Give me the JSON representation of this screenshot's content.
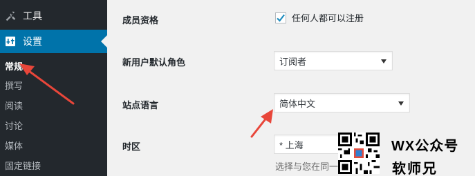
{
  "sidebar": {
    "tools_label": "工具",
    "settings_label": "设置",
    "submenu": [
      "常规",
      "撰写",
      "阅读",
      "讨论",
      "媒体",
      "固定链接"
    ]
  },
  "form": {
    "membership": {
      "label": "成员资格",
      "checkbox_label": "任何人都可以注册",
      "checked": true
    },
    "default_role": {
      "label": "新用户默认角色",
      "value": "订阅者"
    },
    "site_language": {
      "label": "站点语言",
      "value": "简体中文"
    },
    "timezone": {
      "label": "时区",
      "value": "* 上海",
      "hint": "选择与您在同一"
    }
  },
  "watermark": {
    "line1": "WX公众号",
    "line2": "软师兄"
  },
  "colors": {
    "sidebar_bg": "#23282d",
    "active_menu": "#0073aa",
    "annotation_red": "#e8463a",
    "page_bg": "#f1f1f1"
  }
}
